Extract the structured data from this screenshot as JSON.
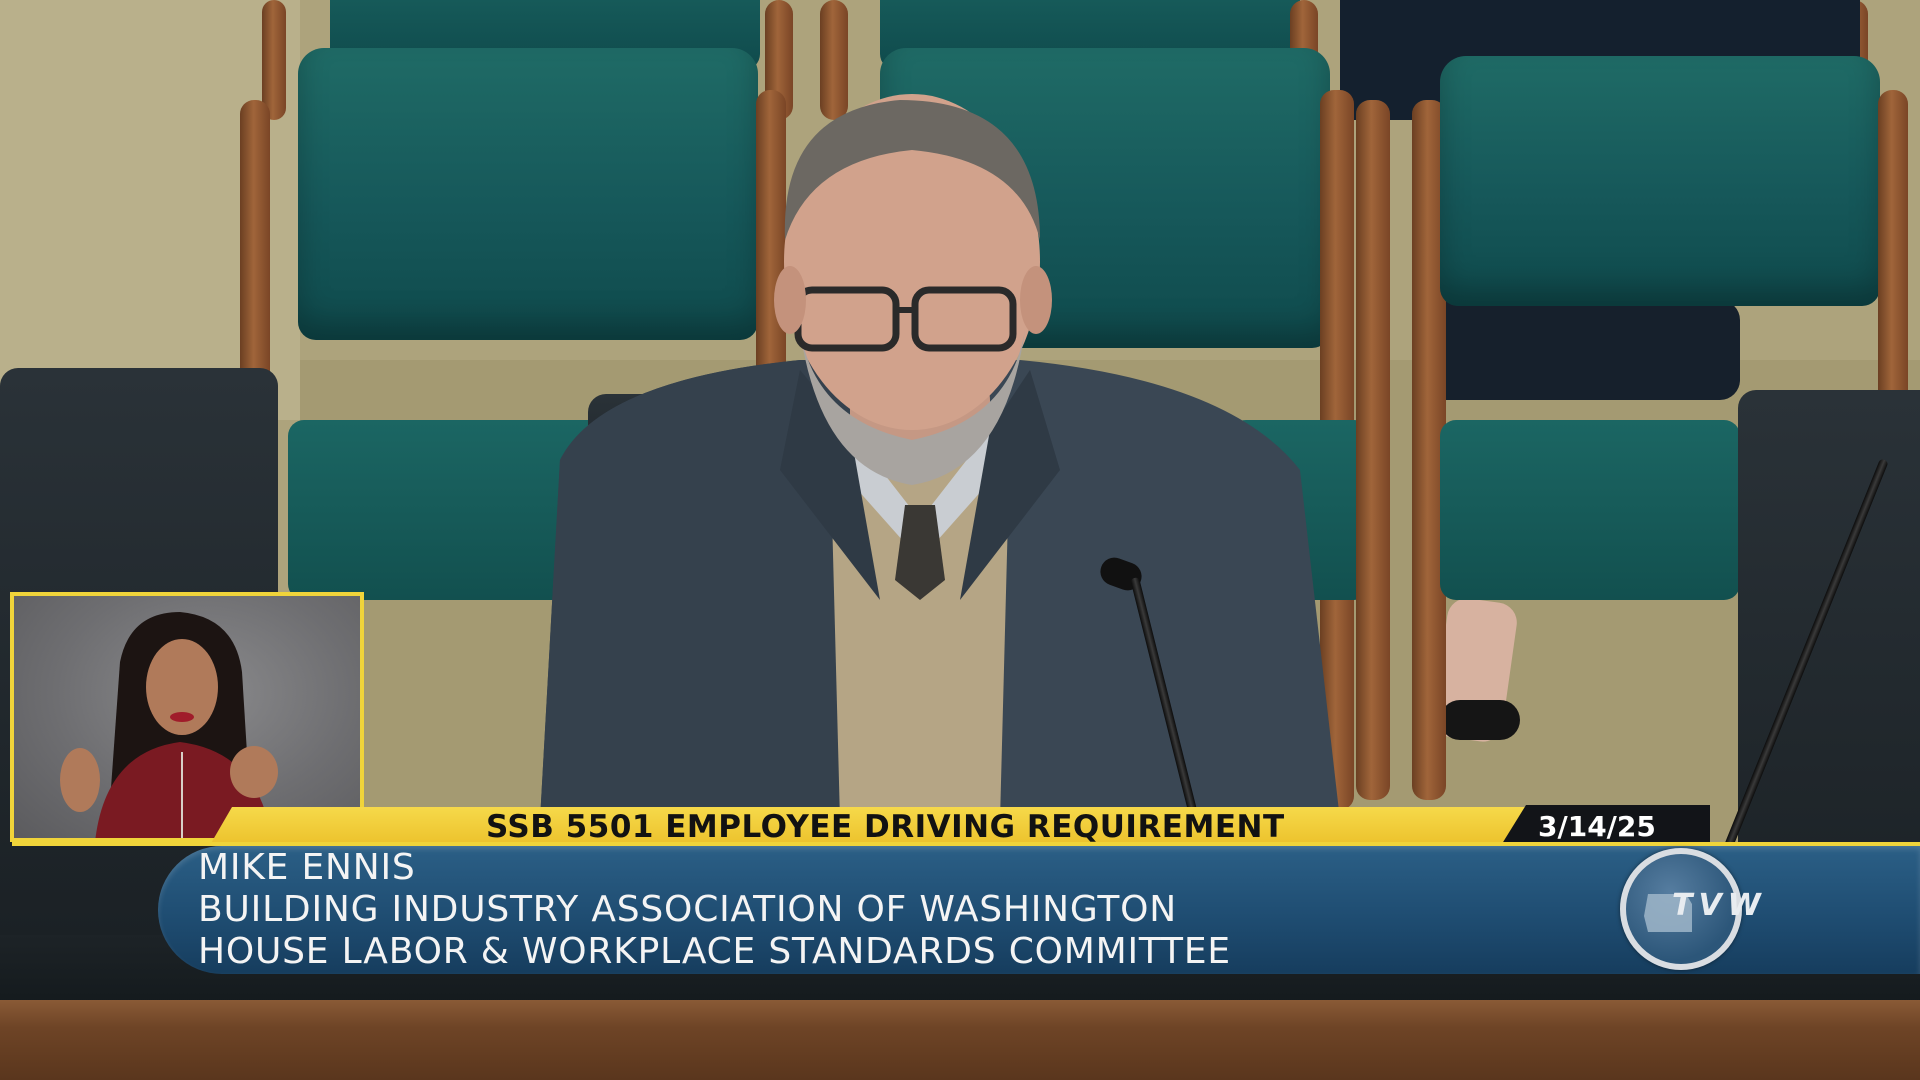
{
  "broadcast": {
    "bill_title": "SSB 5501 EMPLOYEE DRIVING REQUIREMENT",
    "date": "3/14/25",
    "speaker_name": "MIKE ENNIS",
    "speaker_organization": "BUILDING INDUSTRY ASSOCIATION OF WASHINGTON",
    "committee": "HOUSE LABOR & WORKPLACE STANDARDS COMMITTEE",
    "network_logo_text": "TVW"
  },
  "colors": {
    "accent_yellow": "#f0d43a",
    "lower_third_blue": "#1f4d72",
    "chair_teal": "#16585a",
    "date_tab": "#121418"
  },
  "icons": {
    "network_logo": "tvw-logo-icon"
  }
}
